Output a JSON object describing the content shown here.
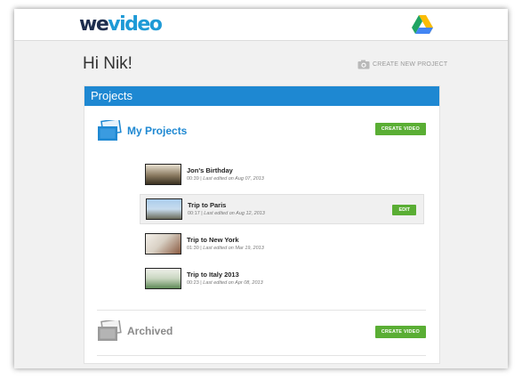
{
  "header": {
    "logo_we": "we",
    "logo_video": "video"
  },
  "greeting": "Hi Nik!",
  "create_new_project": "CREATE NEW PROJECT",
  "panel": {
    "title": "Projects",
    "my_projects": {
      "title": "My Projects",
      "button": "CREATE VIDEO"
    },
    "projects": [
      {
        "title": "Jon's Birthday",
        "duration": "00:39",
        "edited": "Last edited on Aug 07, 2013"
      },
      {
        "title": "Trip to Paris",
        "duration": "00:17",
        "edited": "Last edited on Aug 12, 2013",
        "action": "EDIT"
      },
      {
        "title": "Trip to New York",
        "duration": "01:30",
        "edited": "Last edited on Mar 19, 2013"
      },
      {
        "title": "Trip to Italy 2013",
        "duration": "00:23",
        "edited": "Last edited on Apr 08, 2013"
      }
    ],
    "archived": {
      "title": "Archived",
      "button": "CREATE VIDEO"
    }
  },
  "colors": {
    "accent_blue": "#1e88d2",
    "green": "#5aae34",
    "logo_dark": "#1e2e4e",
    "logo_blue": "#1e9ad6"
  }
}
